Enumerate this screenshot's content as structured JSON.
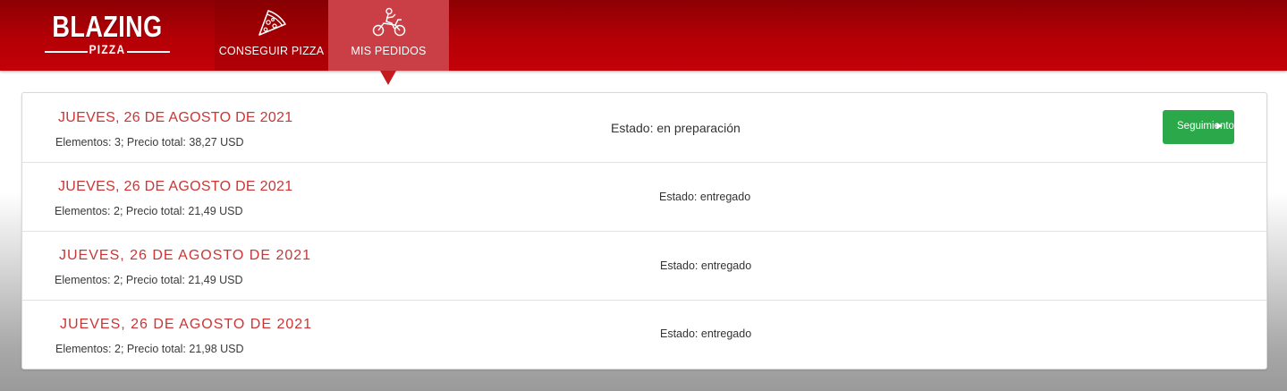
{
  "brand": {
    "name": "BLAZING",
    "sub": "PIZZA"
  },
  "nav": {
    "tabs": [
      {
        "label": "CONSEGUIR PIZZA",
        "icon": "pizza-slice-icon",
        "active": false
      },
      {
        "label": "MIS PEDIDOS",
        "icon": "motorbike-delivery-icon",
        "active": true
      }
    ]
  },
  "orders": [
    {
      "date": "JUEVES, 26 DE AGOSTO DE 2021",
      "summary": "Elementos: 3; Precio total: 38,27 USD",
      "status": "Estado: en preparación",
      "action_label": "Seguimiento",
      "action_icon": "chevron-right-icon"
    },
    {
      "date": "JUEVES, 26 DE AGOSTO DE 2021",
      "summary": "Elementos: 2; Precio total: 21,49 USD",
      "status": "Estado: entregado"
    },
    {
      "date": "JUEVES, 26 DE AGOSTO DE 2021",
      "summary": "Elementos: 2; Precio total: 21,49 USD",
      "status": "Estado: entregado"
    },
    {
      "date": "JUEVES, 26 DE AGOSTO DE 2021",
      "summary": "Elementos: 2; Precio total: 21,98 USD",
      "status": "Estado: entregado"
    }
  ],
  "colors": {
    "brand_red": "#b40006",
    "active_tab": "#c93f45",
    "date_text": "#cc3535",
    "track_button": "#2aa84a"
  }
}
